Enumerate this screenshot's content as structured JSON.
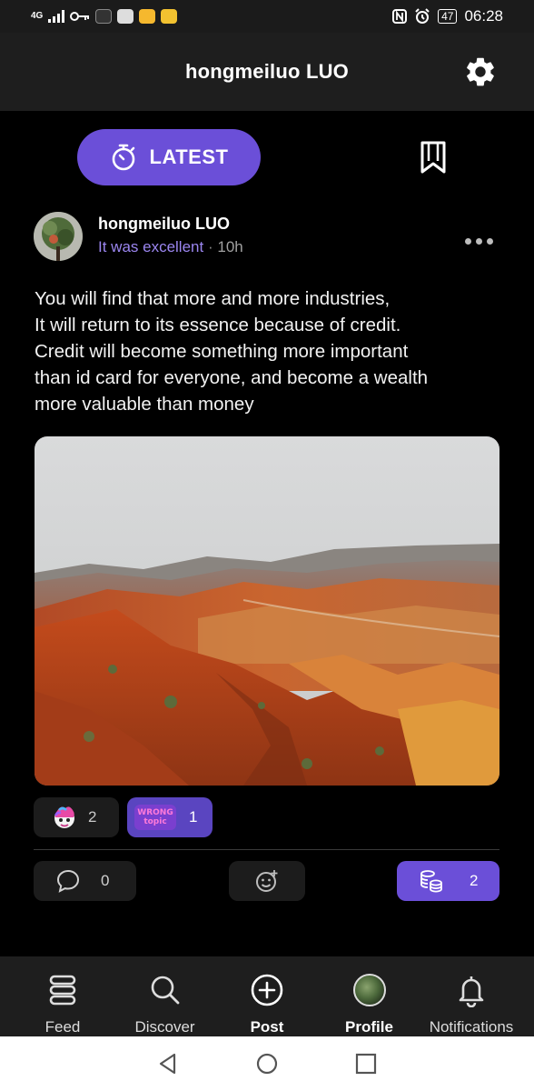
{
  "status_bar": {
    "network": "4G",
    "time": "06:28",
    "battery": "47"
  },
  "header": {
    "title": "hongmeiluo LUO"
  },
  "tabs": {
    "latest_label": "LATEST"
  },
  "post": {
    "author": "hongmeiluo LUO",
    "topic": "It was excellent",
    "separator": "·",
    "time": "10h",
    "text_lines": [
      "You will find that more and more industries,",
      "It will return to its essence because of credit.",
      "Credit will become something more important",
      "than id card for everyone, and become a wealth",
      "more valuable than money"
    ],
    "reactions": [
      {
        "icon": "unicorn-emoji-icon",
        "count": "2"
      },
      {
        "icon": "wrong-topic-sticker-icon",
        "sticker_lines": [
          "WRONG",
          "topic"
        ],
        "count": "1"
      }
    ],
    "actions": {
      "comments": "0",
      "tips": "2"
    }
  },
  "bottom_nav": [
    {
      "label": "Feed",
      "icon": "feed-icon"
    },
    {
      "label": "Discover",
      "icon": "search-icon"
    },
    {
      "label": "Post",
      "icon": "plus-circle-icon"
    },
    {
      "label": "Profile",
      "icon": "avatar"
    },
    {
      "label": "Notifications",
      "icon": "bell-icon"
    }
  ],
  "colors": {
    "accent": "#6b4fd8",
    "topic": "#9b86f0",
    "background": "#000000",
    "bar": "#1e1e1e"
  }
}
